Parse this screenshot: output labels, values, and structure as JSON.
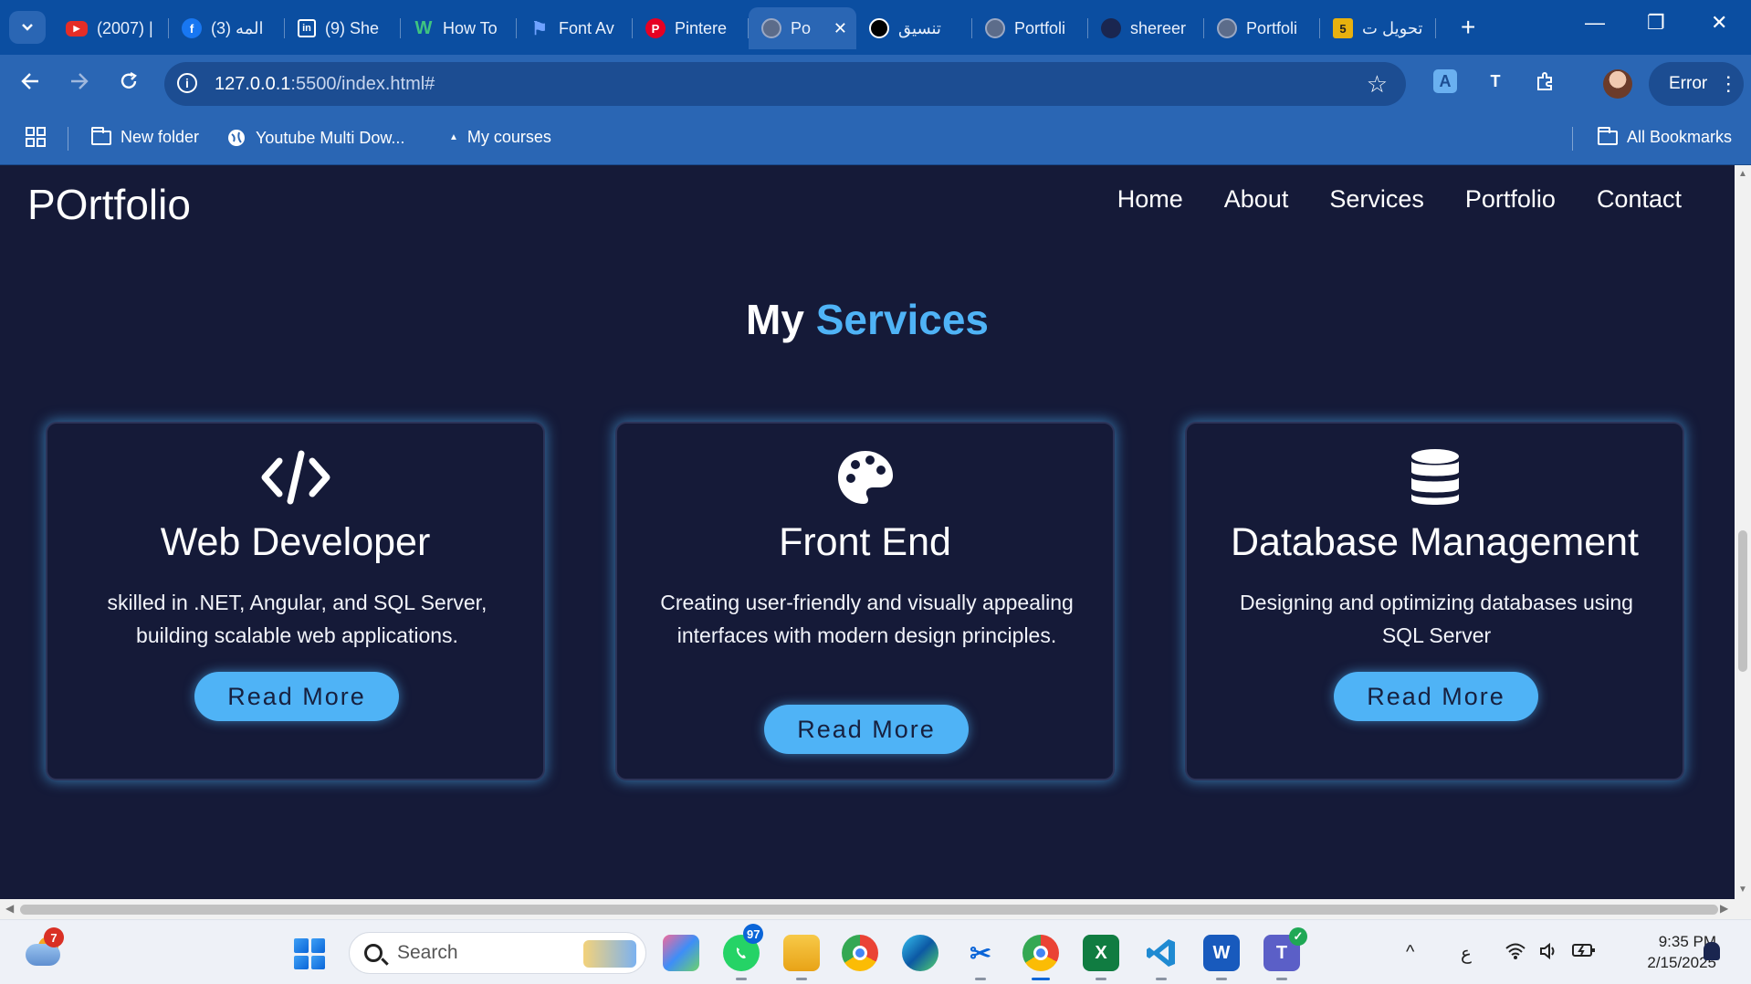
{
  "browser": {
    "tabs": [
      {
        "label": "(2007) |",
        "icon": "youtube-icon",
        "active": false
      },
      {
        "label": "(3) المه",
        "icon": "facebook-icon",
        "active": false
      },
      {
        "label": "(9) She",
        "icon": "linkedin-icon",
        "active": false
      },
      {
        "label": "How To",
        "icon": "w-logo-icon",
        "active": false
      },
      {
        "label": "Font Av",
        "icon": "flag-icon",
        "active": false
      },
      {
        "label": "Pintere",
        "icon": "pinterest-icon",
        "active": false
      },
      {
        "label": "Po",
        "icon": "globe-icon",
        "active": true
      },
      {
        "label": "تنسيق",
        "icon": "openai-icon",
        "active": false
      },
      {
        "label": "Portfoli",
        "icon": "globe-icon",
        "active": false
      },
      {
        "label": "shereer",
        "icon": "github-icon",
        "active": false
      },
      {
        "label": "Portfoli",
        "icon": "globe-icon",
        "active": false
      },
      {
        "label": "تحويل ت",
        "icon": "numbered-5-icon",
        "active": false
      }
    ],
    "tab_icon_text": {
      "youtube": "▶",
      "facebook": "f",
      "linkedin": "in",
      "w": "W",
      "flag": "⚑",
      "pinterest": "P",
      "number": "5"
    },
    "tab_close": "✕",
    "new_tab": "+",
    "window_controls": {
      "minimize": "—",
      "maximize": "❐",
      "close": "✕"
    },
    "address": {
      "host": "127.0.0.1",
      "rest": ":5500/index.html#"
    },
    "error_label": "Error",
    "bookmarks": {
      "apps": "apps-grid-icon",
      "items": [
        {
          "label": "New folder",
          "icon": "folder-icon"
        },
        {
          "label": "Youtube Multi Dow...",
          "icon": "globe-icon"
        },
        {
          "label": "My courses",
          "icon": "triangle-icon"
        }
      ],
      "all": "All Bookmarks"
    }
  },
  "site": {
    "logo": "POrtfolio",
    "nav": [
      "Home",
      "About",
      "Services",
      "Portfolio",
      "Contact"
    ],
    "section_title_plain": "My ",
    "section_title_highlight": "Services",
    "accent": "#4fb3f6",
    "background": "#151a38",
    "cards": [
      {
        "icon": "code-icon",
        "title": "Web Developer",
        "description": "skilled in .NET, Angular, and SQL Server, building scalable web applications.",
        "button": "Read More"
      },
      {
        "icon": "palette-icon",
        "title": "Front End",
        "description": "Creating user-friendly and visually appealing interfaces with modern design principles.",
        "button": "Read More"
      },
      {
        "icon": "database-icon",
        "title": "Database Management",
        "description": "Designing and optimizing databases using SQL Server",
        "button": "Read More"
      }
    ]
  },
  "taskbar": {
    "weather_badge": "7",
    "search_placeholder": "Search",
    "whatsapp_badge": "97",
    "apps": [
      "copilot-icon",
      "whatsapp-icon",
      "file-explorer-icon",
      "chrome-icon",
      "edge-icon",
      "snipping-tool-icon",
      "chrome-profile-icon",
      "excel-icon",
      "vscode-icon",
      "word-icon",
      "teams-icon"
    ],
    "app_letters": {
      "excel": "X",
      "word": "W",
      "teams": "T"
    },
    "tray": {
      "chevron": "^",
      "language": "ع"
    },
    "time": "9:35 PM",
    "date": "2/15/2025"
  }
}
